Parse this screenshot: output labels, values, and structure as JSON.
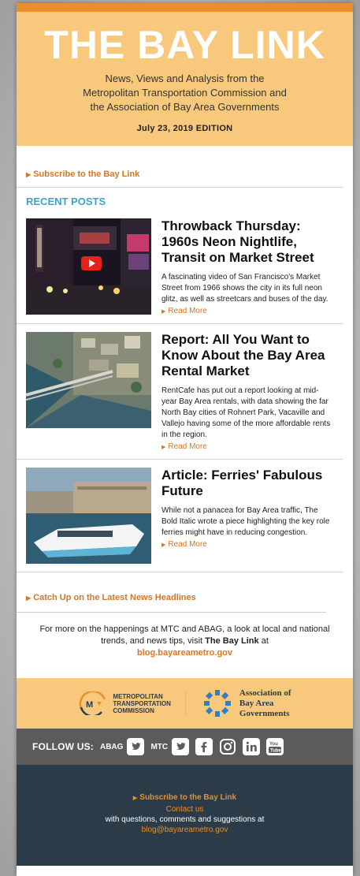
{
  "header": {
    "logo": "THE BAY LINK",
    "tagline_1": "News, Views and Analysis from the",
    "tagline_2": "Metropolitan Transportation Commission and",
    "tagline_3": "the Association of Bay Area Governments",
    "edition": "July 23, 2019 EDITION"
  },
  "subscribe_link": "Subscribe to the Bay Link",
  "recent_title": "RECENT POSTS",
  "posts": [
    {
      "title": "Throwback Thursday: 1960s Neon Nightlife, Transit on Market Street",
      "desc": "A fascinating video of San Francisco's Market Street from 1966 shows the city in its full neon glitz, as well as streetcars and buses of the day.",
      "more": "Read More"
    },
    {
      "title": "Report: All You Want to Know About the Bay Area Rental Market",
      "desc": "RentCafe has put out a report looking at mid-year Bay Area rentals, with data showing the far North Bay cities of Rohnert Park, Vacaville and Vallejo having some of the more affordable rents in the region.",
      "more": "Read More"
    },
    {
      "title": "Article: Ferries' Fabulous Future",
      "desc": "While not a panacea for Bay Area traffic, The Bold Italic wrote a piece highlighting the key role ferries might have in reducing congestion.",
      "more": "Read More"
    }
  ],
  "catchup_link": "Catch Up on the Latest News Headlines",
  "blurb": {
    "text": "For more on the happenings at MTC and ABAG, a look at local and national trends, and news tips, visit",
    "bold": "The Bay Link",
    "at": "at",
    "url": "blog.bayareametro.gov"
  },
  "orgs": {
    "mtc_1": "METROPOLITAN",
    "mtc_2": "TRANSPORTATION",
    "mtc_3": "COMMISSION",
    "abag_1": "Association of",
    "abag_2": "Bay Area",
    "abag_3": "Governments"
  },
  "follow": {
    "label": "FOLLOW US:",
    "abag": "ABAG",
    "mtc": "MTC",
    "icons": [
      "twitter-icon",
      "twitter-icon",
      "facebook-icon",
      "instagram-icon",
      "linkedin-icon",
      "youtube-icon"
    ]
  },
  "footer": {
    "subscribe": "Subscribe to the Bay Link",
    "contact": "Contact us",
    "line": "with questions, comments and suggestions at",
    "email": "blog@bayareametro.gov"
  },
  "colors": {
    "accent_orange": "#e98f2b",
    "header_bg": "#f8c97d",
    "section_blue": "#3aa3cf",
    "footer_bg": "#2b3b47"
  }
}
